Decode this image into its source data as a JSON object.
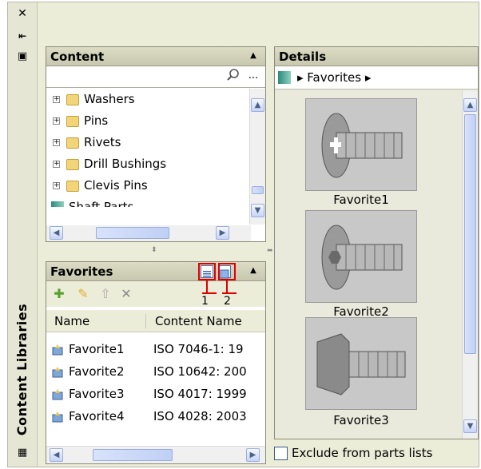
{
  "sidebar": {
    "title": "Content Libraries",
    "close_glyph": "✕",
    "autohide_glyph": "⇤",
    "properties_glyph": "▣"
  },
  "content_panel": {
    "title": "Content",
    "search_value": "",
    "more_label": "...",
    "tree_items": [
      {
        "label": "Washers",
        "type": "folder"
      },
      {
        "label": "Pins",
        "type": "folder"
      },
      {
        "label": "Rivets",
        "type": "folder"
      },
      {
        "label": "Drill Bushings",
        "type": "folder"
      },
      {
        "label": "Clevis Pins",
        "type": "folder"
      },
      {
        "label": "Shaft Parts",
        "type": "shaft"
      }
    ]
  },
  "favorites_panel": {
    "title": "Favorites",
    "columns": [
      "Name",
      "Content Name"
    ],
    "rows": [
      {
        "name": "Favorite1",
        "content": "ISO 7046-1: 19"
      },
      {
        "name": "Favorite2",
        "content": "ISO 10642: 200"
      },
      {
        "name": "Favorite3",
        "content": "ISO 4017: 1999"
      },
      {
        "name": "Favorite4",
        "content": "ISO 4028: 2003"
      }
    ],
    "callouts": [
      "1",
      "2"
    ]
  },
  "details_panel": {
    "title": "Details",
    "breadcrumb": "▸ Favorites ▸",
    "items": [
      {
        "label": "Favorite1",
        "icon": "countersunk-phillips-screw"
      },
      {
        "label": "Favorite2",
        "icon": "countersunk-hex-socket-screw"
      },
      {
        "label": "Favorite3",
        "icon": "hex-head-bolt"
      }
    ],
    "exclude_label": "Exclude from parts lists",
    "exclude_checked": false
  },
  "colors": {
    "frame": "#ecedd8",
    "callout_red": "#e00000",
    "scroll_blue": "#c6d4f6"
  }
}
